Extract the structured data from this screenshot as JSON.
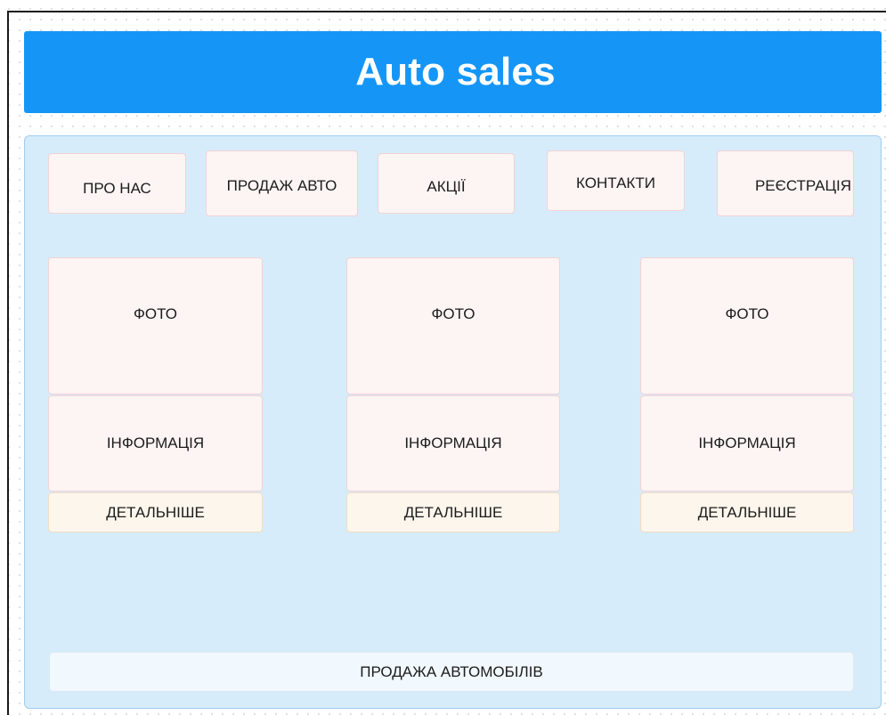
{
  "header": {
    "title": "Auto sales"
  },
  "nav": {
    "items": [
      {
        "label": "ПРО НАС"
      },
      {
        "label": "ПРОДАЖ АВТО"
      },
      {
        "label": "АКЦІЇ"
      },
      {
        "label": "КОНТАКТИ"
      },
      {
        "label": "РЕЄСТРАЦІЯ"
      }
    ]
  },
  "cards": [
    {
      "photo": "ФОТО",
      "info": "ІНФОРМАЦІЯ",
      "details": "ДЕТАЛЬНІШЕ"
    },
    {
      "photo": "ФОТО",
      "info": "ІНФОРМАЦІЯ",
      "details": "ДЕТАЛЬНІШЕ"
    },
    {
      "photo": "ФОТО",
      "info": "ІНФОРМАЦІЯ",
      "details": "ДЕТАЛЬНІШЕ"
    }
  ],
  "footer": {
    "label": "ПРОДАЖА АВТОМОБІЛІВ"
  },
  "colors": {
    "header_bg": "#1596f7",
    "main_bg": "#d6ecfb",
    "box_bg": "#fdf4f4",
    "details_bg": "#fdf6ec",
    "footer_bg": "#f1f8fe"
  }
}
